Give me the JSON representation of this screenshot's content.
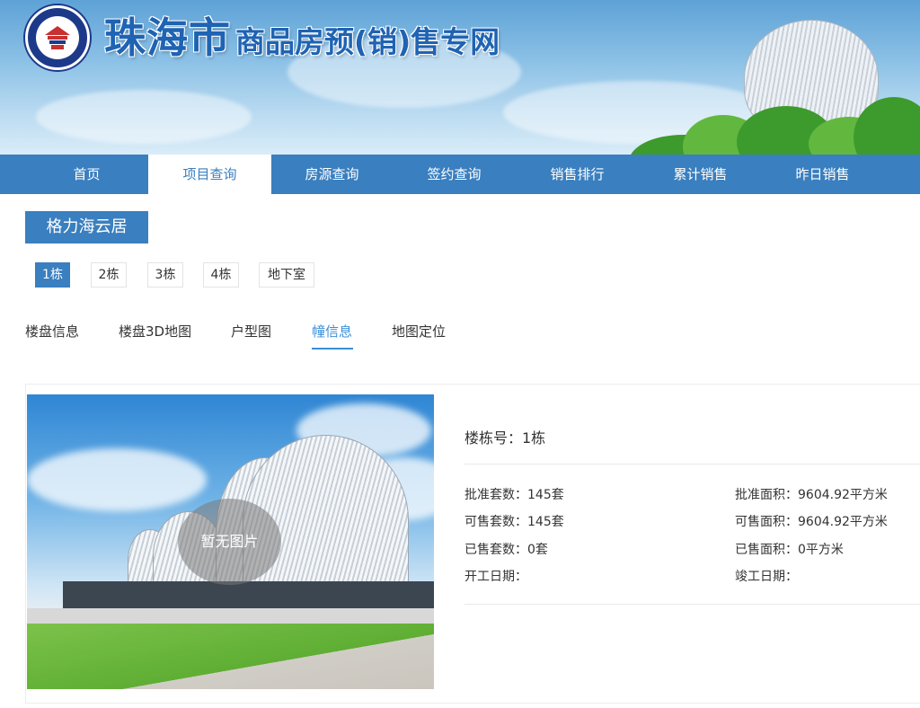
{
  "header": {
    "title_city": "珠海市",
    "title_rest": "商品房预(销)售专网",
    "logo_icon": "real-estate-registration-logo"
  },
  "nav": {
    "items": [
      {
        "label": "首页",
        "active": false
      },
      {
        "label": "项目查询",
        "active": true
      },
      {
        "label": "房源查询",
        "active": false
      },
      {
        "label": "签约查询",
        "active": false
      },
      {
        "label": "销售排行",
        "active": false
      },
      {
        "label": "累计销售",
        "active": false
      },
      {
        "label": "昨日销售",
        "active": false
      }
    ]
  },
  "project": {
    "name": "格力海云居"
  },
  "buildings": [
    {
      "label": "1栋",
      "active": true
    },
    {
      "label": "2栋",
      "active": false
    },
    {
      "label": "3栋",
      "active": false
    },
    {
      "label": "4栋",
      "active": false
    },
    {
      "label": "地下室",
      "active": false
    }
  ],
  "info_tabs": [
    {
      "label": "楼盘信息",
      "active": false
    },
    {
      "label": "楼盘3D地图",
      "active": false
    },
    {
      "label": "户型图",
      "active": false
    },
    {
      "label": "幢信息",
      "active": true
    },
    {
      "label": "地图定位",
      "active": false
    }
  ],
  "detail": {
    "no_image_text": "暂无图片",
    "building_no": "楼栋号：1栋",
    "approved_units": "批准套数：145套",
    "approved_area": "批准面积：9604.92平方米",
    "available_units": "可售套数：145套",
    "available_area": "可售面积：9604.92平方米",
    "sold_units": "已售套数：0套",
    "sold_area": "已售面积：0平方米",
    "start_date": "开工日期：",
    "completion_date": "竣工日期："
  },
  "colors": {
    "primary": "#3a7fbf",
    "active_tab": "#3a8fd9"
  }
}
